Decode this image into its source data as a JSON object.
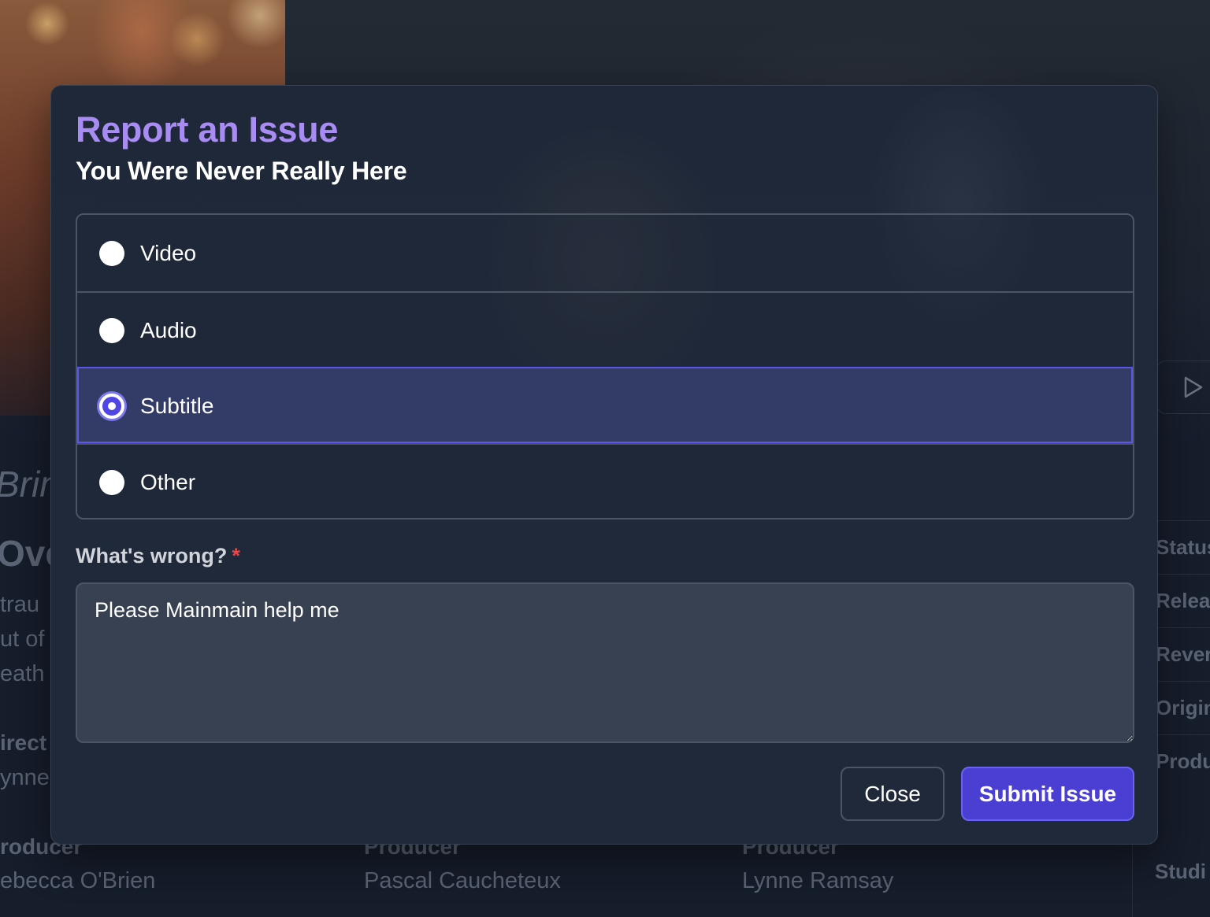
{
  "background": {
    "tagline": "Brin",
    "overview_heading": "Ove",
    "overview_lines": [
      "trau",
      "ut of",
      "eath"
    ],
    "director_role": "irect",
    "director_name": "ynne",
    "crew": [
      {
        "role": "roducer",
        "name": "ebecca O'Brien"
      },
      {
        "role": "Producer",
        "name": "Pascal Caucheteux"
      },
      {
        "role": "Producer",
        "name": "Lynne Ramsay"
      }
    ],
    "side_rows": [
      "Status",
      "Releas",
      "Rever",
      "Origin",
      "Produ"
    ],
    "side_footer": "Studi"
  },
  "modal": {
    "title": "Report an Issue",
    "subtitle": "You Were Never Really Here",
    "options": [
      {
        "label": "Video",
        "selected": false
      },
      {
        "label": "Audio",
        "selected": false
      },
      {
        "label": "Subtitle",
        "selected": true
      },
      {
        "label": "Other",
        "selected": false
      }
    ],
    "field_label": "What's wrong?",
    "required_marker": "*",
    "textarea_value": "Please Mainmain help me",
    "close_label": "Close",
    "submit_label": "Submit Issue"
  },
  "icons": {
    "play": "play-icon",
    "resize": "resize-handle-icon"
  },
  "colors": {
    "accent_title": "#a98bf4",
    "primary": "#4a3fd2",
    "selected_bg": "#323c66",
    "required": "#ef4444"
  }
}
